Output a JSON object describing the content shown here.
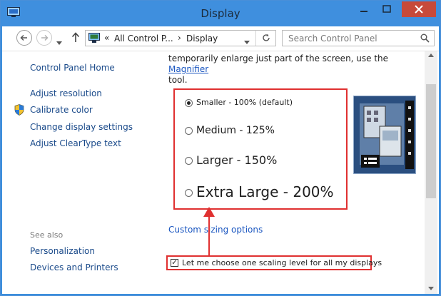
{
  "window": {
    "title": "Display",
    "colors": {
      "title_bar": "#3f8fde",
      "close": "#c74a3a",
      "accent_red": "#e03030",
      "link": "#1a56c0"
    }
  },
  "nav": {
    "back_icon": "arrow-left-icon",
    "forward_icon": "arrow-right-icon",
    "up_icon": "arrow-up-icon",
    "address": {
      "icon": "control-panel-icon",
      "chevrons": "«",
      "segments": [
        "All Control P...",
        "Display"
      ],
      "separator": "›"
    },
    "search_placeholder": "Search Control Panel"
  },
  "sidebar": {
    "home": "Control Panel Home",
    "links": [
      "Adjust resolution",
      "Calibrate color",
      "Change display settings",
      "Adjust ClearType text"
    ],
    "see_also_title": "See also",
    "see_also_links": [
      "Personalization",
      "Devices and Printers"
    ]
  },
  "main": {
    "intro_text_before": "temporarily enlarge just part of the screen, use the ",
    "intro_link": "Magnifier",
    "intro_text_after": "tool.",
    "options": [
      {
        "label": "Smaller - 100% (default)",
        "checked": true
      },
      {
        "label": "Medium - 125%",
        "checked": false
      },
      {
        "label": "Larger - 150%",
        "checked": false
      },
      {
        "label": "Extra Large - 200%",
        "checked": false
      }
    ],
    "custom_link": "Custom sizing options",
    "checkbox_label": "Let me choose one scaling level for all my displays",
    "checkbox_checked": true
  }
}
